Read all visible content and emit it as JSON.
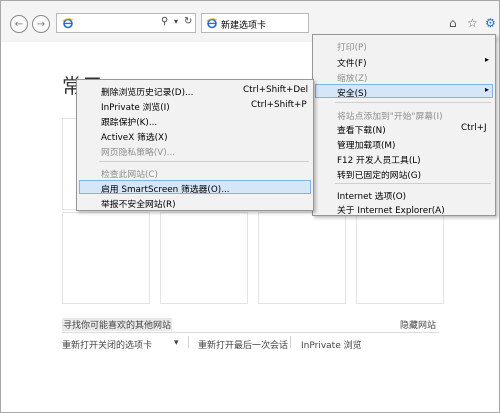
{
  "toolbar": {
    "back_glyph": "←",
    "forward_glyph": "→",
    "address_value": "",
    "search_glyph": "⚲",
    "dropdown_glyph": "▾",
    "refresh_glyph": "↻",
    "tab_label": "新建选项卡",
    "home_glyph": "⌂",
    "favorites_glyph": "☆",
    "tools_glyph": "⚙"
  },
  "page": {
    "heading": "常用",
    "discover_link": "寻找你可能喜欢的其他网站",
    "hide_sites": "隐藏网站",
    "reopen_closed_tabs": "重新打开关闭的选项卡",
    "reopen_dropdown": "▾",
    "reopen_last_session": "重新打开最后一次会话",
    "inprivate": "InPrivate 浏览"
  },
  "tools_menu": {
    "items": [
      {
        "label": "打印(P)",
        "disabled": false
      },
      {
        "label": "文件(F)",
        "disabled": false,
        "submenu": "▸"
      },
      {
        "label": "缩放(Z)",
        "disabled": false
      },
      {
        "label": "安全(S)",
        "disabled": false,
        "submenu": "▸"
      },
      {
        "label": "将站点添加到\"开始\"屏幕(I)",
        "disabled": true
      },
      {
        "label": "查看下载(N)",
        "shortcut": "Ctrl+J"
      },
      {
        "label": "管理加载项(M)"
      },
      {
        "label": "F12 开发人员工具(L)"
      },
      {
        "label": "转到已固定的网站(G)"
      },
      {
        "label": "Internet 选项(O)"
      },
      {
        "label": "关于 Internet Explorer(A)"
      }
    ]
  },
  "safety_menu": {
    "items": [
      {
        "label": "删除浏览历史记录(D)...",
        "shortcut": "Ctrl+Shift+Del"
      },
      {
        "label": "InPrivate 浏览(I)",
        "shortcut": "Ctrl+Shift+P"
      },
      {
        "label": "跟踪保护(K)..."
      },
      {
        "label": "ActiveX 筛选(X)"
      },
      {
        "label": "网页隐私策略(V)...",
        "disabled": true
      },
      {
        "label": "检查此网站(C)",
        "disabled": true
      },
      {
        "label": "启用 SmartScreen 筛选器(O)..."
      },
      {
        "label": "举报不安全网站(R)"
      }
    ]
  },
  "colors": {
    "highlight_bg": "#d5e6f9",
    "highlight_border": "#7eb4ea",
    "menu_bg": "#f2f2f2",
    "ie_blue": "#1e6fd9"
  }
}
